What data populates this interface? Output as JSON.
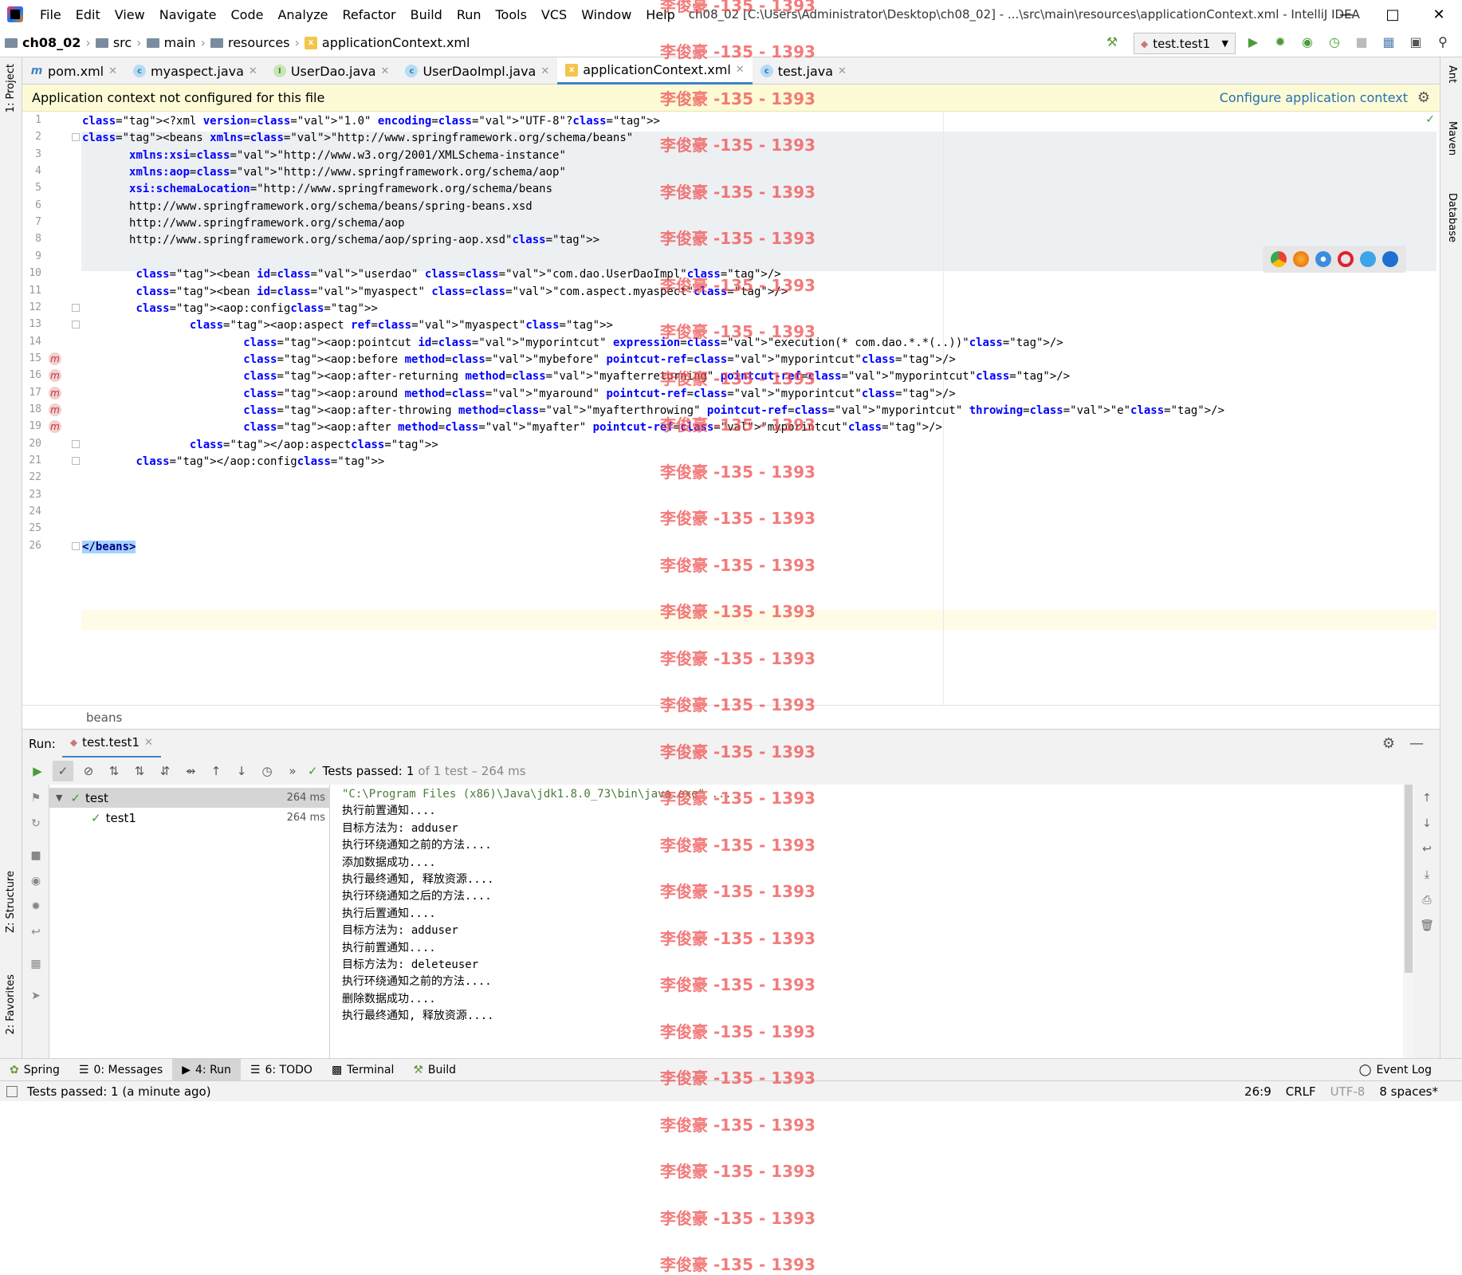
{
  "titlebar": {
    "menus": [
      "File",
      "Edit",
      "View",
      "Navigate",
      "Code",
      "Analyze",
      "Refactor",
      "Build",
      "Run",
      "Tools",
      "VCS",
      "Window",
      "Help"
    ],
    "window_title": "ch08_02 [C:\\Users\\Administrator\\Desktop\\ch08_02] - ...\\src\\main\\resources\\applicationContext.xml - IntelliJ IDEA"
  },
  "breadcrumb": [
    "ch08_02",
    "src",
    "main",
    "resources",
    "applicationContext.xml"
  ],
  "run_config": "test.test1",
  "left_tools": {
    "project": "1: Project",
    "structure": "Z: Structure",
    "favorites": "2: Favorites"
  },
  "right_tools": [
    "Ant",
    "Maven",
    "Database"
  ],
  "tabs": [
    {
      "label": "pom.xml",
      "icon": "m"
    },
    {
      "label": "myaspect.java",
      "icon": "c"
    },
    {
      "label": "UserDao.java",
      "icon": "i"
    },
    {
      "label": "UserDaoImpl.java",
      "icon": "c"
    },
    {
      "label": "applicationContext.xml",
      "icon": "xml"
    },
    {
      "label": "test.java",
      "icon": "c"
    }
  ],
  "notice": {
    "text": "Application context not configured for this file",
    "link": "Configure application context"
  },
  "code_lines": [
    "<?xml version=\"1.0\" encoding=\"UTF-8\"?>",
    "<beans xmlns=\"http://www.springframework.org/schema/beans\"",
    "       xmlns:xsi=\"http://www.w3.org/2001/XMLSchema-instance\"",
    "       xmlns:aop=\"http://www.springframework.org/schema/aop\"",
    "       xsi:schemaLocation=\"http://www.springframework.org/schema/beans",
    "       http://www.springframework.org/schema/beans/spring-beans.xsd",
    "       http://www.springframework.org/schema/aop",
    "       http://www.springframework.org/schema/aop/spring-aop.xsd\">",
    "",
    "        <bean id=\"userdao\" class=\"com.dao.UserDaoImpl\"/>",
    "        <bean id=\"myaspect\" class=\"com.aspect.myaspect\"/>",
    "        <aop:config>",
    "                <aop:aspect ref=\"myaspect\">",
    "                        <aop:pointcut id=\"myporintcut\" expression=\"execution(* com.dao.*.*(..))\"/>",
    "                        <aop:before method=\"mybefore\" pointcut-ref=\"myporintcut\"/>",
    "                        <aop:after-returning method=\"myafterreturning\" pointcut-ref=\"myporintcut\"/>",
    "                        <aop:around method=\"myaround\" pointcut-ref=\"myporintcut\"/>",
    "                        <aop:after-throwing method=\"myafterthrowing\" pointcut-ref=\"myporintcut\" throwing=\"e\"/>",
    "                        <aop:after method=\"myafter\" pointcut-ref=\"myporintcut\"/>",
    "                </aop:aspect>",
    "        </aop:config>",
    "",
    "",
    "",
    "",
    "</beans>"
  ],
  "editor_breadcrumb": "beans",
  "run_panel": {
    "label": "Run:",
    "tab": "test.test1",
    "status_prefix": "Tests passed:",
    "status_count": "1",
    "status_suffix": "of 1 test – 264 ms",
    "tree": [
      {
        "name": "test",
        "duration": "264 ms"
      },
      {
        "name": "test1",
        "duration": "264 ms"
      }
    ],
    "console": [
      "\"C:\\Program Files (x86)\\Java\\jdk1.8.0_73\\bin\\java.exe\" ...",
      "执行前置通知....",
      "目标方法为: adduser",
      "执行环绕通知之前的方法....",
      "添加数据成功....",
      "执行最终通知, 释放资源....",
      "执行环绕通知之后的方法....",
      "执行后置通知....",
      "目标方法为: adduser",
      "执行前置通知....",
      "目标方法为: deleteuser",
      "执行环绕通知之前的方法....",
      "删除数据成功....",
      "执行最终通知, 释放资源...."
    ]
  },
  "tool_windows": [
    "Spring",
    "0: Messages",
    "4: Run",
    "6: TODO",
    "Terminal",
    "Build"
  ],
  "event_log": "Event Log",
  "status": {
    "message": "Tests passed: 1 (a minute ago)",
    "position": "26:9",
    "line_sep": "CRLF",
    "encoding": "UTF-8",
    "indent": "8 spaces*"
  },
  "watermark": "李俊豪 -135 - 1393",
  "colors": {
    "accent": "#4083c9",
    "notice_bg": "#fdfbd6",
    "link": "#2470b3",
    "pass": "#3a9a3a"
  }
}
